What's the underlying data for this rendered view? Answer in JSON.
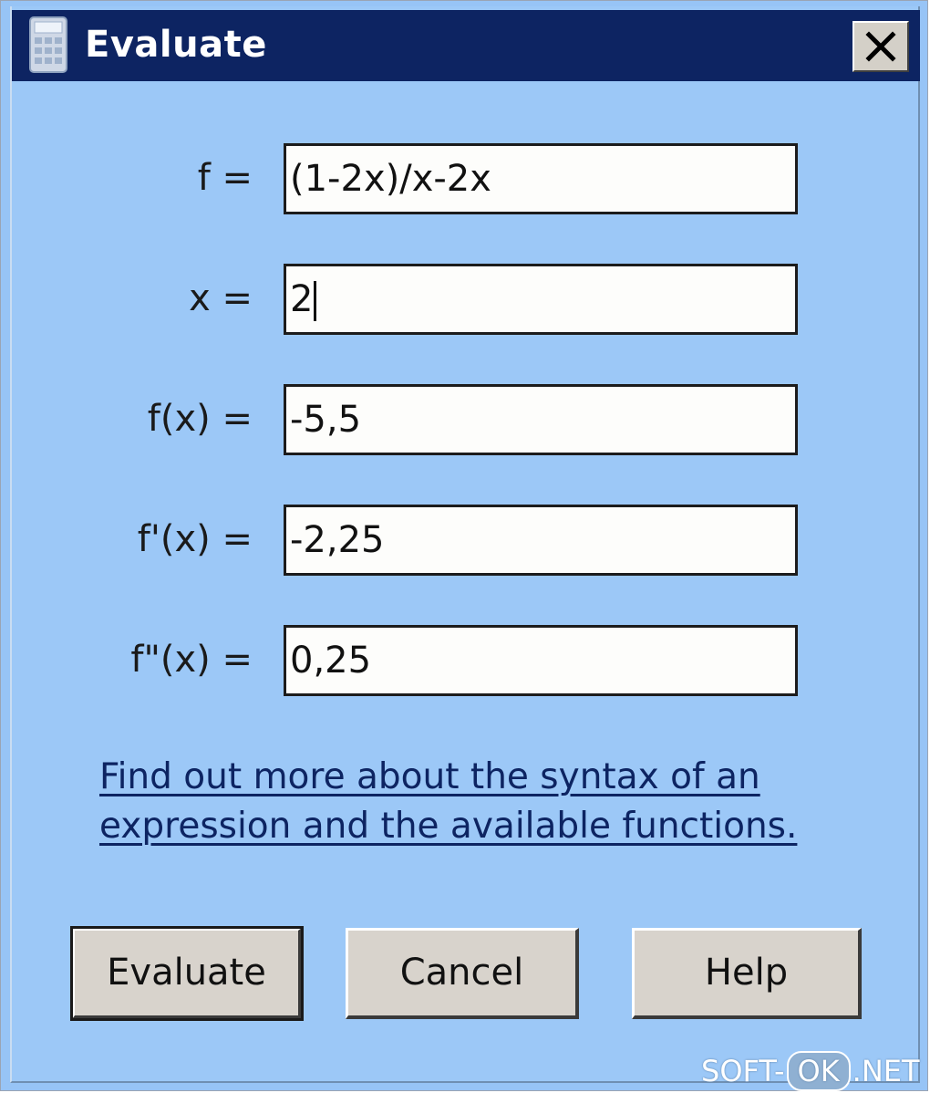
{
  "window": {
    "title": "Evaluate",
    "app_icon": "calculator-icon",
    "close_icon": "close-icon"
  },
  "fields": {
    "f": {
      "label": "f =",
      "value": "(1-2x)/x-2x"
    },
    "x": {
      "label": "x =",
      "value": "2"
    },
    "fx": {
      "label": "f(x) =",
      "value": "-5,5"
    },
    "f1x": {
      "label": "f'(x) =",
      "value": "-2,25"
    },
    "f2x": {
      "label": "f\"(x) =",
      "value": "0,25"
    }
  },
  "link": {
    "line1": "Find out more about the syntax of an",
    "line2": "expression and the available functions."
  },
  "buttons": {
    "evaluate": "Evaluate",
    "cancel": "Cancel",
    "help": "Help"
  },
  "watermark": {
    "left": "SOFT-",
    "badge": "OK",
    "right": ".NET"
  },
  "colors": {
    "title_bar": "#0d2462",
    "dialog_bg": "#9cc8f7",
    "button_face": "#d8d3cc"
  }
}
